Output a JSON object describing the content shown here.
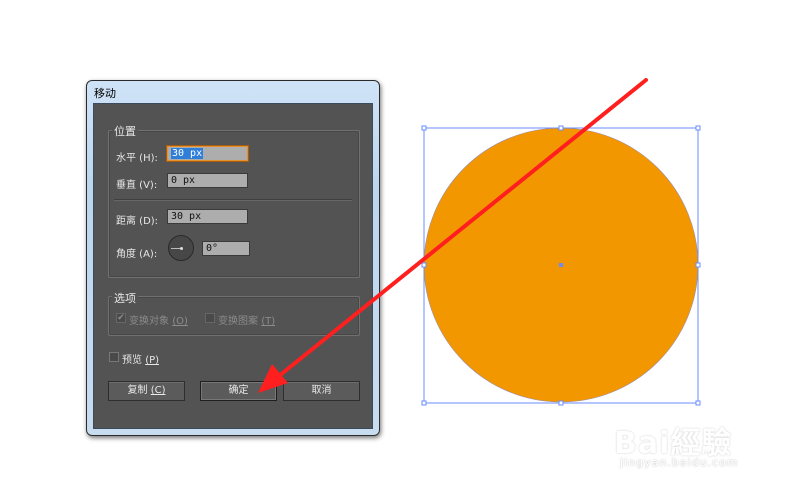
{
  "dialog": {
    "title": "移动",
    "position_group": {
      "label": "位置",
      "horizontal_label": "水平 (H):",
      "horizontal_value": "30 px",
      "vertical_label": "垂直 (V):",
      "vertical_value": "0 px",
      "distance_label": "距离 (D):",
      "distance_value": "30 px",
      "angle_label": "角度 (A):",
      "angle_value": "0°"
    },
    "options_group": {
      "label": "选项",
      "transform_objects_label": "变换对象",
      "transform_objects_key": "(O)",
      "transform_objects_checked": true,
      "transform_patterns_label": "变换图案",
      "transform_patterns_key": "(T)",
      "transform_patterns_checked": false
    },
    "preview_label": "预览",
    "preview_key": "(P)",
    "preview_checked": false,
    "buttons": {
      "copy": "复制",
      "copy_key": "(C)",
      "ok": "确定",
      "cancel": "取消"
    }
  },
  "canvas": {
    "circle_fill": "#f39700",
    "selection_color": "#6a8cff",
    "arrow_color": "#ff1f1f"
  },
  "watermark": {
    "brand": "Bai經驗",
    "url": "jingyan.baidu.com"
  }
}
